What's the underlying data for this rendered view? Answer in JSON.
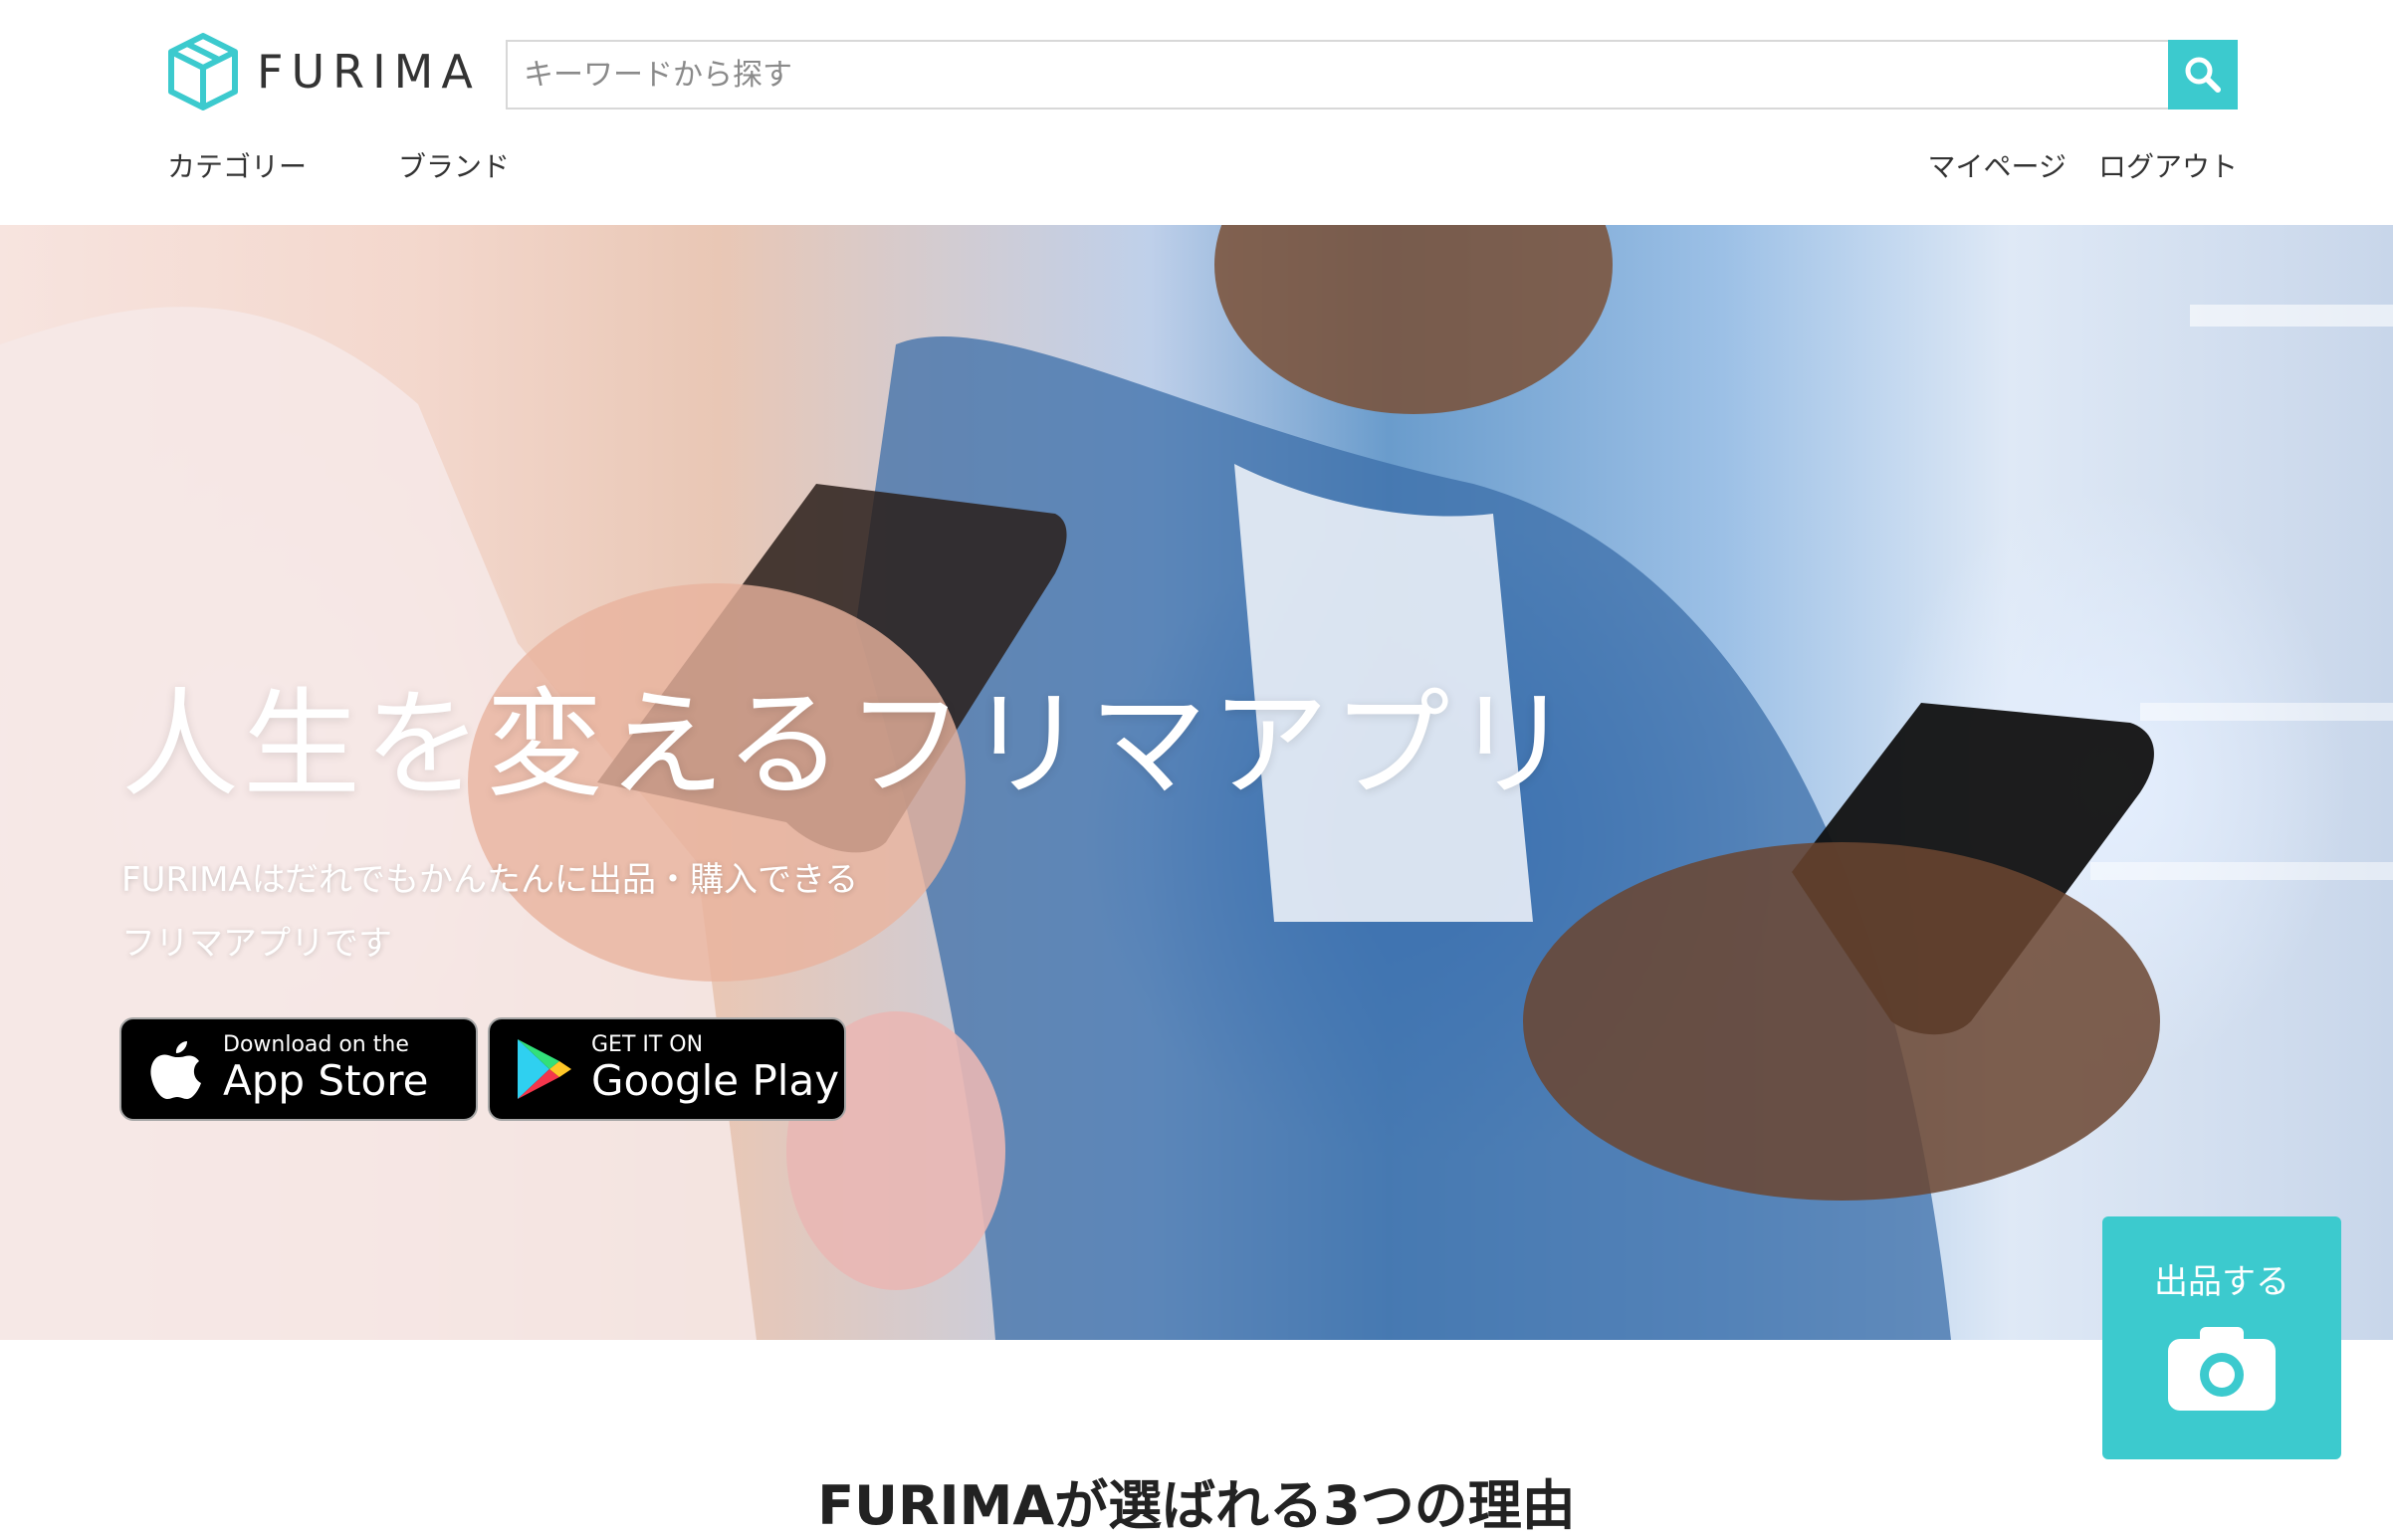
{
  "brand": {
    "name": "FURIMA",
    "accent_color": "#3ccace"
  },
  "search": {
    "placeholder": "キーワードから探す",
    "value": "",
    "button_icon": "search-icon"
  },
  "nav": {
    "left": [
      "カテゴリー",
      "ブランド"
    ],
    "right": [
      "マイページ",
      "ログアウト"
    ]
  },
  "hero": {
    "title": "人生を変えるフリマアプリ",
    "desc_line1": "FURIMAはだれでもかんたんに出品・購入できる",
    "desc_line2": "フリマアプリです"
  },
  "app_store": {
    "small": "Download on the",
    "big": "App Store",
    "icon": "apple-icon"
  },
  "google_play": {
    "small": "GET IT ON",
    "big": "Google Play",
    "icon": "google-play-icon"
  },
  "sell": {
    "label": "出品する",
    "icon": "camera-icon"
  },
  "reasons": {
    "title": "FURIMAが選ばれる3つの理由"
  }
}
